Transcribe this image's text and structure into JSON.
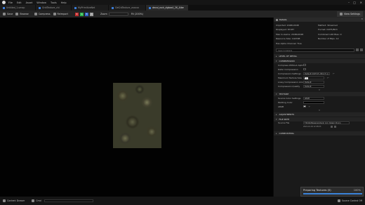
{
  "menu": {
    "items": [
      "File",
      "Edit",
      "Asset",
      "Window",
      "Tools",
      "Help"
    ]
  },
  "tabs": [
    {
      "label": "Untitled_1.umap",
      "active": false
    },
    {
      "label": "GridTexture_chi",
      "active": false
    },
    {
      "label": "MyPrimitiveNet",
      "active": false
    },
    {
      "label": "Get2dTexture_zxxxxx",
      "active": false
    },
    {
      "label": "decal_rock_dgkaa4_2K_Albe",
      "active": true
    }
  ],
  "toolbar": {
    "save_label": "Save",
    "browse_label": "Browse",
    "compress_label": "Compress",
    "reimport_label": "Reimport",
    "channels": [
      "R",
      "G",
      "B",
      "A"
    ],
    "zoom_label": "Zoom",
    "fit_label": "Fit (200%)",
    "view_settings_label": "View Settings"
  },
  "details": {
    "tab_label": "Details",
    "info_left": [
      "Imported: 2048x2048",
      "Displayed: 87x87",
      "Max In-Game: 2048x2048",
      "Resource Size: 1447KB",
      "Has Alpha Channel: True"
    ],
    "info_right": [
      "Method: Streamed",
      "Format: DXT5/BC3",
      "Combined LOD Bias: 0",
      "Number of Mips: 12",
      ""
    ],
    "search_placeholder": "Search Details",
    "categories": {
      "level_of_detail": "LEVEL OF DETAIL",
      "compression": "COMPRESSION",
      "texture": "TEXTURE",
      "adjustments": "ADJUSTMENTS",
      "file_path": "FILE PATH",
      "compositing": "COMPOSITING"
    },
    "compression_props": [
      {
        "label": "Compress Without Alpha",
        "type": "check",
        "checked": false
      },
      {
        "label": "Defer Compression",
        "type": "check",
        "checked": false
      },
      {
        "label": "Compression Settings",
        "type": "select",
        "value": "Default (DXT1/5, BC1/3 on DX11)"
      },
      {
        "label": "Maximum Texture Size",
        "type": "input",
        "value": "512"
      },
      {
        "label": "Lossy Compression Amount",
        "type": "select",
        "value": "Default"
      },
      {
        "label": "Compression Quality",
        "type": "select",
        "value": "Default"
      }
    ],
    "texture_props": [
      {
        "label": "Source Color Settings",
        "type": "select",
        "value": "sRGB"
      },
      {
        "label": "Padding Color",
        "type": "input",
        "value": ""
      },
      {
        "label": "sRGB",
        "type": "check",
        "checked": true
      }
    ],
    "file_path": {
      "label": "Source File",
      "value": "F:/Dolts/Megascans/decal_rock_dgkaa4_2K.png",
      "date": "2022-10-04 12:28:03"
    }
  },
  "statusbar": {
    "content_drawer": "Content Drawer",
    "cmd_label": "Cmd",
    "cmd_placeholder": "Enter Console Command",
    "source_control": "Source Control Off"
  },
  "toast": {
    "title": "Preparing Textures (0)",
    "percent_text": "100%",
    "progress": 1.0
  },
  "colors": {
    "channel_r": "#c42b2b",
    "channel_g": "#2bb24c",
    "channel_b": "#2b5fc4",
    "channel_a": "#9a9a9a",
    "accent": "#3a83d9"
  }
}
